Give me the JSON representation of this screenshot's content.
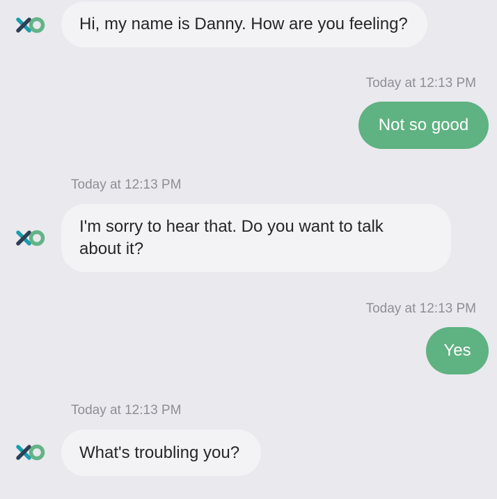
{
  "colors": {
    "background": "#e9e9ee",
    "bot_bubble": "#f3f3f6",
    "user_bubble": "#5fb281",
    "logo_teal": "#1a9cab",
    "logo_dark": "#2b3f56",
    "logo_green": "#63b486",
    "timestamp_text": "#8e8e94"
  },
  "avatar_icon": "xo-logo-icon",
  "messages": [
    {
      "sender": "bot",
      "text": "Hi, my name is Danny. How are you feeling?"
    },
    {
      "sender": "user",
      "timestamp": "Today at 12:13 PM",
      "text": "Not so good"
    },
    {
      "sender": "bot",
      "timestamp": "Today at 12:13 PM",
      "text": "I'm sorry to hear that. Do you want to talk about it?"
    },
    {
      "sender": "user",
      "timestamp": "Today at 12:13 PM",
      "text": "Yes"
    },
    {
      "sender": "bot",
      "timestamp": "Today at 12:13 PM",
      "text": "What's troubling you?"
    }
  ]
}
